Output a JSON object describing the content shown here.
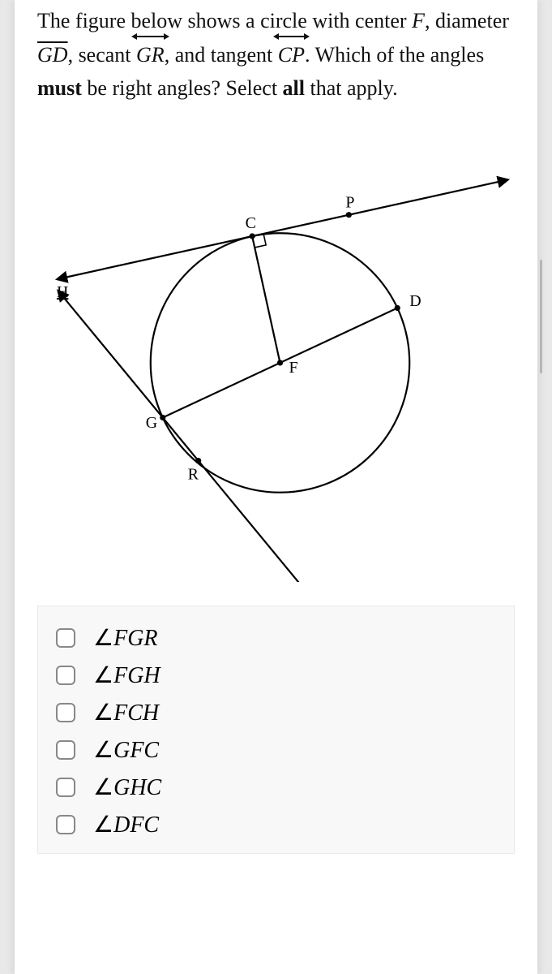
{
  "question": {
    "p1a": "The figure below shows a circle with center ",
    "F": "F",
    "p1b": ", diameter ",
    "GD": "GD",
    "p1c": ", secant ",
    "GR": "GR",
    "p1d": ", and tangent ",
    "CP": "CP",
    "p2a": ". Which of the angles ",
    "must": "must",
    "p2b": " be right angles? Select ",
    "all": "all",
    "p2c": " that apply."
  },
  "diagram": {
    "labels": {
      "P": "P",
      "C": "C",
      "H": "H",
      "D": "D",
      "F": "F",
      "G": "G",
      "R": "R"
    }
  },
  "options": [
    {
      "id": "opt-fgr",
      "sym": "∠",
      "label": "FGR"
    },
    {
      "id": "opt-fgh",
      "sym": "∠",
      "label": "FGH"
    },
    {
      "id": "opt-fch",
      "sym": "∠",
      "label": "FCH"
    },
    {
      "id": "opt-gfc",
      "sym": "∠",
      "label": "GFC"
    },
    {
      "id": "opt-ghc",
      "sym": "∠",
      "label": "GHC"
    },
    {
      "id": "opt-dfc",
      "sym": "∠",
      "label": "DFC"
    }
  ]
}
